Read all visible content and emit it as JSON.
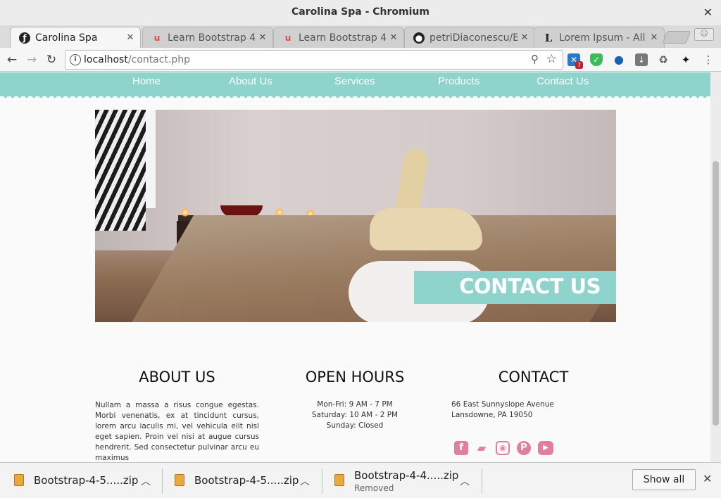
{
  "window": {
    "title": "Carolina Spa - Chromium"
  },
  "tabs": [
    {
      "label": "Carolina Spa",
      "favicon": "symfony-icon",
      "active": true
    },
    {
      "label": "Learn Bootstrap 4",
      "favicon": "udemy-icon",
      "active": false
    },
    {
      "label": "Learn Bootstrap 4",
      "favicon": "udemy-icon",
      "active": false
    },
    {
      "label": "petriDiaconescu/B",
      "favicon": "github-icon",
      "active": false
    },
    {
      "label": "Lorem Ipsum - All",
      "favicon": "lorem-icon",
      "active": false
    }
  ],
  "toolbar": {
    "url_host": "localhost",
    "url_path": "/contact.php",
    "extension_badge": "7"
  },
  "site": {
    "nav": [
      "Home",
      "About Us",
      "Services",
      "Products",
      "Contact Us"
    ],
    "hero_banner": "CONTACT US",
    "about": {
      "title": "ABOUT US",
      "text": "Nullam a massa a risus congue egestas. Morbi venenatis, ex at tincidunt cursus, lorem arcu iaculis mi, vel vehicula elit nisl eget sapien. Proin vel nisi at augue cursus hendrerit. Sed consectetur pulvinar arcu eu maximus"
    },
    "hours": {
      "title": "OPEN HOURS",
      "lines": [
        "Mon-Fri: 9 AM - 7 PM",
        "Saturday: 10 AM - 2 PM",
        "Sunday: Closed"
      ]
    },
    "contact": {
      "title": "CONTACT",
      "lines": [
        "66 East Sunnyslope Avenue",
        "Lansdowne, PA 19050"
      ]
    },
    "social_icons": [
      "facebook-icon",
      "twitter-icon",
      "instagram-icon",
      "pinterest-icon",
      "youtube-icon"
    ],
    "accent_color": "#8fd4cc",
    "social_color": "#e07fa0"
  },
  "downloads": {
    "items": [
      {
        "name": "Bootstrap-4-5.....zip",
        "status": ""
      },
      {
        "name": "Bootstrap-4-5.....zip",
        "status": ""
      },
      {
        "name": "Bootstrap-4-4.....zip",
        "status": "Removed"
      }
    ],
    "show_all": "Show all"
  }
}
